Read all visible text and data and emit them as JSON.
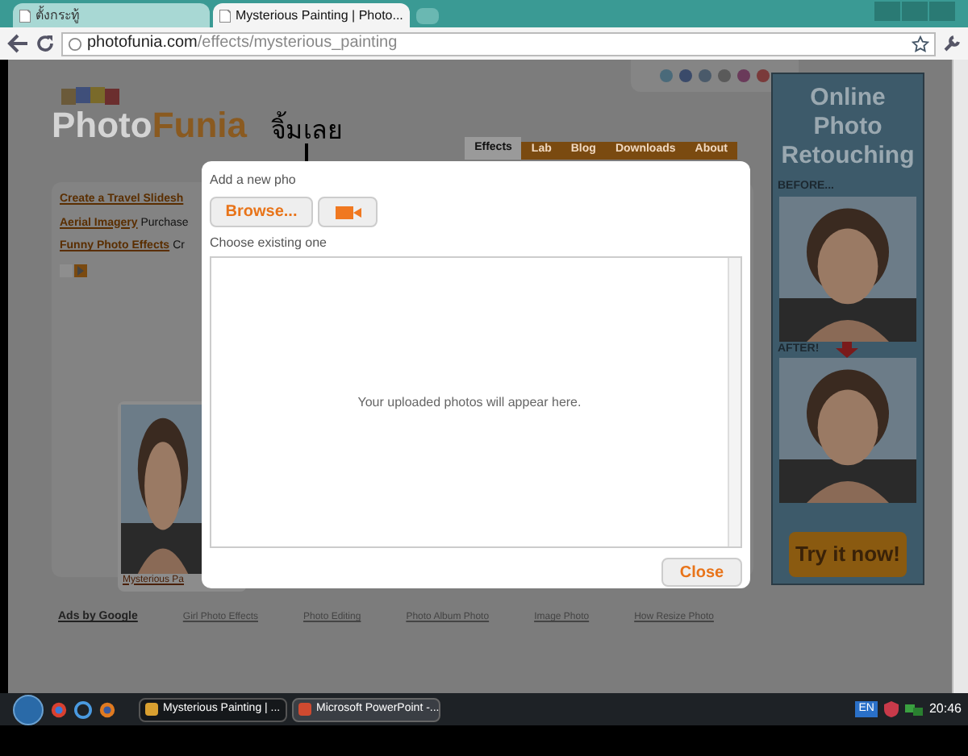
{
  "browser": {
    "tabs": [
      {
        "title": "ตั้งกระทู้",
        "selected": false
      },
      {
        "title": "Mysterious Painting | Photo...",
        "selected": true
      }
    ],
    "url_host": "photofunia.com",
    "url_path": "/effects/mysterious_painting"
  },
  "page": {
    "logo": {
      "part_1": "Photo",
      "part_2": "Funia"
    },
    "nav": [
      {
        "label": "Effects",
        "selected": true
      },
      {
        "label": "Lab",
        "selected": false
      },
      {
        "label": "Blog",
        "selected": false
      },
      {
        "label": "Downloads",
        "selected": false
      },
      {
        "label": "About",
        "selected": false
      }
    ],
    "promo_links": [
      {
        "link": "Create a Travel Slidesh"
      },
      {
        "link": "Aerial Imagery",
        "text": "Purchase"
      },
      {
        "link": "Funny Photo Effects",
        "text": "Cr"
      }
    ],
    "thumbnail": {
      "kind": "picture",
      "caption": "Mysterious Pa"
    },
    "ads_label": "Ads by Google",
    "ad_links": [
      "Girl Photo Effects",
      "Photo Editing",
      "Photo Album Photo",
      "Image Photo",
      "How Resize Photo"
    ],
    "ad_banner": {
      "title": "Online Photo Retouching",
      "before": "BEFORE...",
      "after": "AFTER!",
      "cta": "Try it now!"
    }
  },
  "annotation": "จิ้มเลย",
  "dialog": {
    "add_label": "Add a new pho",
    "browse": "Browse...",
    "choose_label": "Choose existing one",
    "empty_text": "Your uploaded photos will appear here.",
    "close": "Close"
  },
  "taskbar": {
    "items": [
      {
        "title": "Mysterious Painting | ...",
        "selected": true
      },
      {
        "title": "Microsoft PowerPoint -...",
        "selected": false
      }
    ],
    "language": "EN",
    "time": "20:46"
  }
}
